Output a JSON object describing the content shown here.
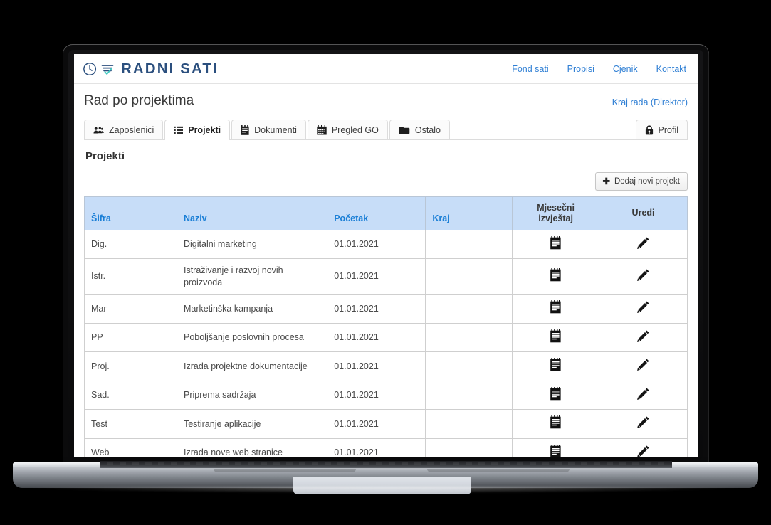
{
  "brand": {
    "name": "RADNI SATI",
    "logo_icons": [
      "clock-icon",
      "checklist-check-icon"
    ]
  },
  "topnav": [
    {
      "label": "Fond sati"
    },
    {
      "label": "Propisi"
    },
    {
      "label": "Cjenik"
    },
    {
      "label": "Kontakt"
    }
  ],
  "header": {
    "page_title": "Rad po projektima",
    "end_work_link": "Kraj rada (Direktor)"
  },
  "tabs": [
    {
      "label": "Zaposlenici",
      "icon": "users-icon",
      "active": false
    },
    {
      "label": "Projekti",
      "icon": "list-icon",
      "active": true
    },
    {
      "label": "Dokumenti",
      "icon": "notepad-icon",
      "active": false
    },
    {
      "label": "Pregled GO",
      "icon": "calendar-icon",
      "active": false
    },
    {
      "label": "Ostalo",
      "icon": "folder-icon",
      "active": false
    }
  ],
  "profile_tab": {
    "label": "Profil",
    "icon": "lock-icon"
  },
  "main": {
    "section_title": "Projekti",
    "add_button": {
      "label": "Dodaj novi projekt",
      "icon": "plus-icon"
    },
    "table": {
      "columns": [
        "Šifra",
        "Naziv",
        "Početak",
        "Kraj",
        "Mjesečni izvještaj",
        "Uredi"
      ],
      "column_header_lines": {
        "monthly_report": [
          "Mjesečni",
          "izvještaj"
        ]
      },
      "rows": [
        {
          "sifra": "Dig.",
          "naziv": "Digitalni marketing",
          "pocetak": "01.01.2021",
          "kraj": "",
          "report_icon": "report-icon",
          "edit_icon": "pencil-icon"
        },
        {
          "sifra": "Istr.",
          "naziv": "Istraživanje i razvoj novih proizvoda",
          "pocetak": "01.01.2021",
          "kraj": "",
          "report_icon": "report-icon",
          "edit_icon": "pencil-icon"
        },
        {
          "sifra": "Mar",
          "naziv": "Marketinška kampanja",
          "pocetak": "01.01.2021",
          "kraj": "",
          "report_icon": "report-icon",
          "edit_icon": "pencil-icon"
        },
        {
          "sifra": "PP",
          "naziv": "Poboljšanje poslovnih procesa",
          "pocetak": "01.01.2021",
          "kraj": "",
          "report_icon": "report-icon",
          "edit_icon": "pencil-icon"
        },
        {
          "sifra": "Proj.",
          "naziv": "Izrada projektne dokumentacije",
          "pocetak": "01.01.2021",
          "kraj": "",
          "report_icon": "report-icon",
          "edit_icon": "pencil-icon"
        },
        {
          "sifra": "Sad.",
          "naziv": "Priprema sadržaja",
          "pocetak": "01.01.2021",
          "kraj": "",
          "report_icon": "report-icon",
          "edit_icon": "pencil-icon"
        },
        {
          "sifra": "Test",
          "naziv": "Testiranje aplikacije",
          "pocetak": "01.01.2021",
          "kraj": "",
          "report_icon": "report-icon",
          "edit_icon": "pencil-icon"
        },
        {
          "sifra": "Web",
          "naziv": "Izrada nove web stranice",
          "pocetak": "01.01.2021",
          "kraj": "",
          "report_icon": "report-icon",
          "edit_icon": "pencil-icon"
        }
      ]
    }
  },
  "colors": {
    "brand_navy": "#2b4f7e",
    "link_blue": "#2f7fd4",
    "table_header_bg": "#c7ddf8",
    "table_header_text": "#1b7fd6",
    "logo_check_teal": "#3fc9c0"
  }
}
